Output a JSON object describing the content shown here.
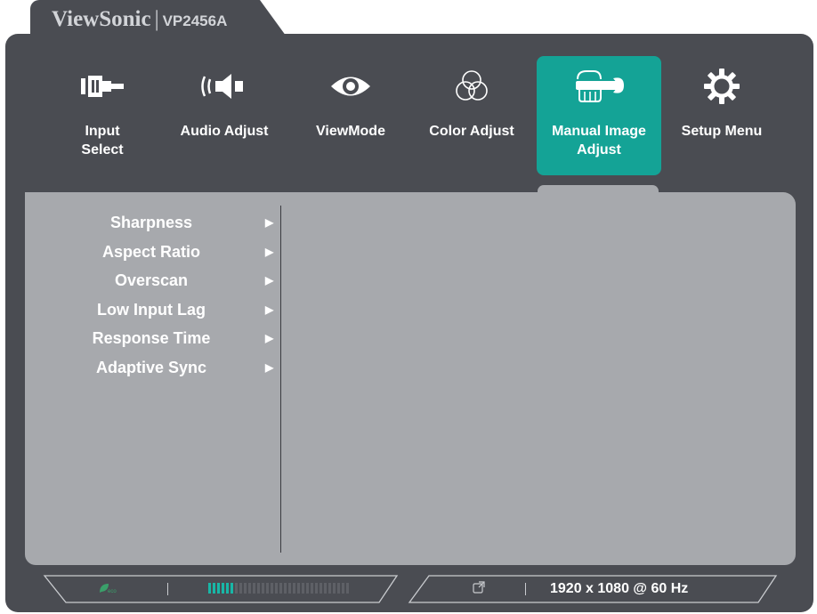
{
  "brand": {
    "logo": "ViewSonic",
    "separator": "|",
    "model": "VP2456A"
  },
  "tabs": [
    {
      "label": "Input Select",
      "icon": "input-select-icon"
    },
    {
      "label": "Audio Adjust",
      "icon": "audio-speaker-icon"
    },
    {
      "label": "ViewMode",
      "icon": "eye-icon"
    },
    {
      "label": "Color Adjust",
      "icon": "color-circles-icon"
    },
    {
      "label": "Manual Image Adjust",
      "icon": "hand-wrench-icon",
      "active": true
    },
    {
      "label": "Setup Menu",
      "icon": "gear-icon"
    }
  ],
  "menu": {
    "items": [
      {
        "label": "Sharpness",
        "arrow": "▶"
      },
      {
        "label": "Aspect Ratio",
        "arrow": "▶"
      },
      {
        "label": "Overscan",
        "arrow": "▶"
      },
      {
        "label": "Low Input Lag",
        "arrow": "▶"
      },
      {
        "label": "Response Time",
        "arrow": "▶"
      },
      {
        "label": "Adaptive Sync",
        "arrow": "▶"
      }
    ]
  },
  "status": {
    "eco_label": "eco",
    "eco_icon": "eco-leaf-icon",
    "meter_level": 0.2,
    "external_icon": "external-link-icon",
    "resolution": "1920 x 1080 @ 60 Hz"
  },
  "colors": {
    "frame": "#4a4c52",
    "panel": "#a7a9ad",
    "accent": "#14a396",
    "text": "#ffffff"
  }
}
